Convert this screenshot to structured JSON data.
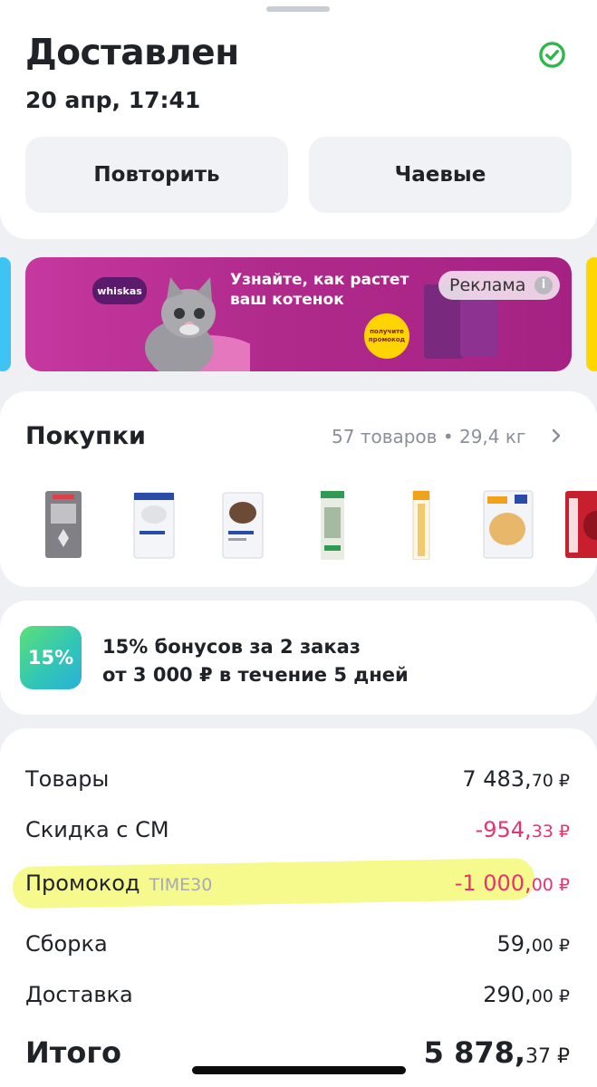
{
  "order": {
    "status": "Доставлен",
    "datetime": "20 апр, 17:41",
    "repeat_label": "Повторить",
    "tips_label": "Чаевые"
  },
  "ad": {
    "brand": "whiskas",
    "headline_line1": "Узнайте, как растет",
    "headline_line2": "ваш котенок",
    "promo_badge_line1": "получите",
    "promo_badge_line2": "промокод",
    "label": "Реклама"
  },
  "purchases": {
    "title": "Покупки",
    "meta": "57 товаров • 29,4 кг",
    "products": [
      {
        "icon": "sugar-pack"
      },
      {
        "icon": "rice-pack"
      },
      {
        "icon": "buckwheat-pack"
      },
      {
        "icon": "cat-treat-sticks"
      },
      {
        "icon": "spaghetti-pack"
      },
      {
        "icon": "rice-noodles-pack"
      },
      {
        "icon": "miratorg-pack"
      }
    ]
  },
  "bonus": {
    "badge": "15%",
    "line1": "15% бонусов за 2 заказ",
    "line2": "от 3 000 ₽ в течение 5 дней"
  },
  "summary": {
    "goods_label": "Товары",
    "goods_main": "7 483,",
    "goods_kop": "70 ₽",
    "discount_label": "Скидка с СМ",
    "discount_main": "-954,",
    "discount_kop": "33 ₽",
    "promo_label": "Промокод",
    "promo_code": "TIME30",
    "promo_main": "-1 000,",
    "promo_kop": "00 ₽",
    "assembly_label": "Сборка",
    "assembly_main": "59,",
    "assembly_kop": "00 ₽",
    "delivery_label": "Доставка",
    "delivery_main": "290,",
    "delivery_kop": "00 ₽",
    "total_label": "Итого",
    "total_main": "5 878,",
    "total_kop": "37 ₽"
  },
  "colors": {
    "accent_green": "#2fb84a",
    "negative_red": "#e8336f",
    "ad_magenta": "#b02a8c"
  }
}
